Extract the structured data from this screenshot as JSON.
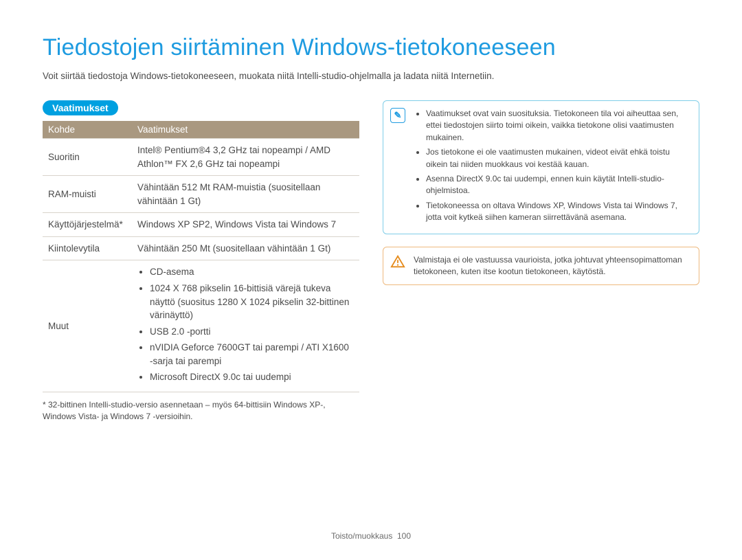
{
  "header": {
    "title": "Tiedostojen siirtäminen Windows-tietokoneeseen",
    "intro": "Voit siirtää tiedostoja Windows-tietokoneeseen, muokata niitä Intelli-studio-ohjelmalla ja ladata niitä Internetiin."
  },
  "section_heading": "Vaatimukset",
  "table": {
    "head_col1": "Kohde",
    "head_col2": "Vaatimukset",
    "rows": {
      "cpu_label": "Suoritin",
      "cpu_value": "Intel® Pentium®4 3,2 GHz tai nopeampi / AMD Athlon™ FX 2,6 GHz tai nopeampi",
      "ram_label": "RAM-muisti",
      "ram_value": "Vähintään 512 Mt RAM-muistia (suositellaan vähintään 1 Gt)",
      "os_label": "Käyttöjärjestelmä*",
      "os_value": "Windows XP SP2, Windows Vista tai Windows 7",
      "hdd_label": "Kiintolevytila",
      "hdd_value": "Vähintään 250 Mt (suositellaan vähintään 1 Gt)",
      "other_label": "Muut",
      "other_items": {
        "i0": "CD-asema",
        "i1": "1024 X 768 pikselin 16-bittisiä värejä tukeva näyttö (suositus 1280 X 1024 pikselin 32-bittinen värinäyttö)",
        "i2": "USB 2.0 -portti",
        "i3": "nVIDIA Geforce 7600GT tai parempi / ATI X1600 -sarja tai parempi",
        "i4": "Microsoft DirectX 9.0c tai uudempi"
      }
    }
  },
  "footnote": "* 32-bittinen Intelli-studio-versio asennetaan – myös 64-bittisiin Windows XP-, Windows Vista- ja Windows 7 -versioihin.",
  "notes": {
    "n0": "Vaatimukset ovat vain suosituksia. Tietokoneen tila voi aiheuttaa sen, ettei tiedostojen siirto toimi oikein, vaikka tietokone olisi vaatimusten mukainen.",
    "n1": "Jos tietokone ei ole vaatimusten mukainen, videot eivät ehkä toistu oikein tai niiden muokkaus voi kestää kauan.",
    "n2": "Asenna DirectX 9.0c tai uudempi, ennen kuin käytät Intelli-studio-ohjelmistoa.",
    "n3": "Tietokoneessa on oltava Windows XP, Windows Vista tai Windows 7, jotta voit kytkeä siihen kameran siirrettävänä asemana."
  },
  "warning": "Valmistaja ei ole vastuussa vaurioista, jotka johtuvat yhteensopimattoman tietokoneen, kuten itse kootun tietokoneen, käytöstä.",
  "footer": {
    "crumb": "Toisto/muokkaus",
    "page": "100"
  }
}
